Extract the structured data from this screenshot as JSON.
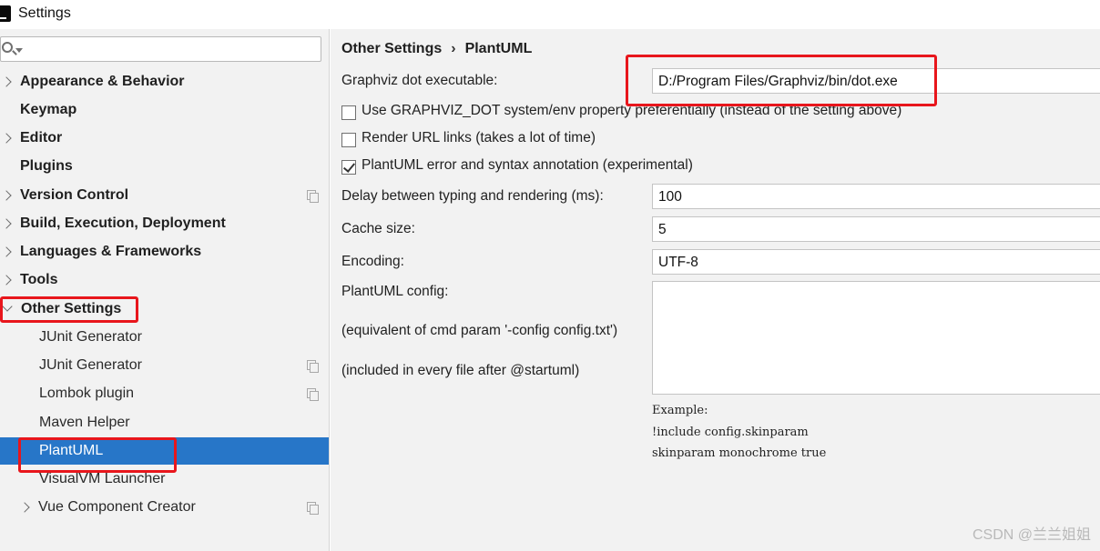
{
  "window": {
    "title": "Settings",
    "app_icon": "intellij-icon"
  },
  "search": {
    "placeholder": "",
    "icon": "search-icon"
  },
  "sidebar": {
    "items": [
      {
        "label": "Appearance & Behavior",
        "level": 0,
        "expandable": true
      },
      {
        "label": "Keymap",
        "level": 0,
        "expandable": false
      },
      {
        "label": "Editor",
        "level": 0,
        "expandable": true
      },
      {
        "label": "Plugins",
        "level": 0,
        "expandable": false
      },
      {
        "label": "Version Control",
        "level": 0,
        "expandable": true,
        "project_icon": true
      },
      {
        "label": "Build, Execution, Deployment",
        "level": 0,
        "expandable": true
      },
      {
        "label": "Languages & Frameworks",
        "level": 0,
        "expandable": true
      },
      {
        "label": "Tools",
        "level": 0,
        "expandable": true
      },
      {
        "label": "Other Settings",
        "level": 0,
        "expanded": true,
        "highlighted": true
      },
      {
        "label": "JUnit Generator",
        "level": 1
      },
      {
        "label": "JUnit Generator",
        "level": 1,
        "project_icon": true
      },
      {
        "label": "Lombok plugin",
        "level": 1,
        "project_icon": true
      },
      {
        "label": "Maven Helper",
        "level": 1
      },
      {
        "label": "PlantUML",
        "level": 1,
        "selected": true,
        "highlighted": true
      },
      {
        "label": "VisualVM Launcher",
        "level": 1
      },
      {
        "label": "Vue Component Creator",
        "level": 1,
        "expandable": true,
        "project_icon": true
      }
    ]
  },
  "main": {
    "breadcrumb": {
      "parent": "Other Settings",
      "separator": "›",
      "current": "PlantUML"
    },
    "graphviz": {
      "label": "Graphviz dot executable:",
      "value": "D:/Program Files/Graphviz/bin/dot.exe",
      "highlighted": true
    },
    "checkboxes": [
      {
        "label": "Use GRAPHVIZ_DOT system/env property preferentially (instead of the setting above)",
        "checked": false
      },
      {
        "label": "Render URL links (takes a lot of time)",
        "checked": false
      },
      {
        "label": "PlantUML error and syntax annotation (experimental)",
        "checked": true
      }
    ],
    "delay": {
      "label": "Delay between typing and rendering (ms):",
      "value": "100"
    },
    "cache": {
      "label": "Cache size:",
      "value": "5"
    },
    "encoding": {
      "label": "Encoding:",
      "value": "UTF-8"
    },
    "config": {
      "label": "PlantUML config:",
      "hint1": "(equivalent of cmd param '-config config.txt')",
      "hint2": "(included in every file after @startuml)",
      "value": ""
    },
    "example": {
      "title": "Example:",
      "line1": "!include config.skinparam",
      "line2": "skinparam monochrome true"
    }
  },
  "watermark": "CSDN @兰兰姐姐",
  "colors": {
    "selection": "#2776c8",
    "highlight_box": "#e8161c",
    "panel_bg": "#f2f2f2"
  }
}
